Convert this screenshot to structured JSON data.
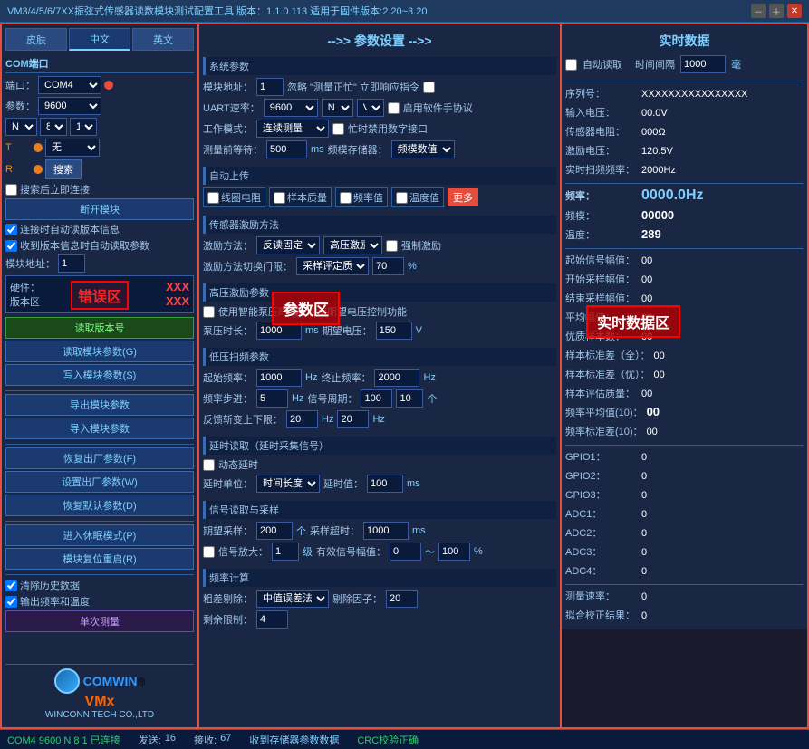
{
  "titlebar": {
    "title": "VM3/4/5/6/7XX振弦式传感器读数模块测试配置工具  版本：1.1.0.113 适用于固件版本:2.20~3.20"
  },
  "tabs": {
    "skin": "皮肤",
    "chinese": "中文",
    "english": "英文"
  },
  "left": {
    "com_section": "COM端口",
    "port_label": "端口：",
    "port_value": "COM4",
    "port_dot": "red",
    "baud_label": "参数：",
    "baud_value": "9600",
    "n_label": "N",
    "b_label": "8",
    "one_label": "1",
    "t_label": "T",
    "r_label": "R",
    "no_label": "无",
    "search_btn": "搜索",
    "auto_connect": "搜索后立即连接",
    "disconnect_btn": "断开模块",
    "auto_version": "连接时自动读版本信息",
    "auto_read": "收到版本信息时自动读取参数",
    "addr_label": "模块地址：",
    "addr_value": "1",
    "hw_label": "硬件：",
    "hw_value": "XXX",
    "sw_label": "版本区",
    "sw_value": "XXX",
    "read_btn": "读取版本号",
    "read_module_btn": "读取模块参数(G)",
    "write_module_btn": "写入模块参数(S)",
    "export_btn": "导出模块参数",
    "import_btn": "导入模块参数",
    "restore_factory_btn": "恢复出厂参数(F)",
    "set_factory_btn": "设置出厂参数(W)",
    "restore_default_btn": "恢复默认参数(D)",
    "sleep_btn": "进入休眠模式(P)",
    "reboot_btn": "模块复位重启(R)",
    "clear_history": "清除历史数据",
    "output_freq_temp": "输出频率和温度",
    "single_measure": "单次测量"
  },
  "middle": {
    "title": "-->>\t参数设置\t -->>",
    "system_params": "系统参数",
    "module_addr_label": "模块地址：",
    "module_addr_value": "1",
    "ignore_label": "忽略 \"测量正忙\" 立即响应指令",
    "uart_label": "UART速率：",
    "uart_value": "9600",
    "n_value": "N",
    "v_value": "V",
    "startup_handshake": "启用软件手协议",
    "work_mode_label": "工作模式：",
    "work_mode_value": "连续测量",
    "busy_disable_digital": "忙时禁用数字接口",
    "wait_ms_label": "测量前等待：",
    "wait_ms_value": "500",
    "wait_ms_unit": "ms",
    "freq_store_label": "频模存储器：",
    "freq_store_value": "频模数值",
    "auto_upload_title": "自动上传",
    "coil_resist": "线圈电阻",
    "sample_quality": "样本质量",
    "freq_value_cb": "频率值",
    "temp_value_cb": "温度值",
    "more_btn": "更多",
    "sensor_excite_title": "传感器激励方法",
    "excite_method_label": "激励方法：",
    "excite_method_value": "反读固定",
    "excite_type_value": "高压激励",
    "force_excite": "强制激励",
    "switch_limit_label": "激励方法切换门限：",
    "switch_limit_value": "采样评定质量值",
    "switch_limit_num": "70",
    "switch_limit_unit": "%",
    "high_voltage_title": "高压激励参数",
    "smart_pump": "使用智能泵压时",
    "param_area": "参数区",
    "enable_period_control": "启用期望电压控制功能",
    "pump_time_label": "泵压时长：",
    "pump_time_value": "1000",
    "pump_time_unit": "ms",
    "expected_voltage_label": "期望电压：",
    "expected_voltage_value": "150",
    "expected_voltage_unit": "V",
    "low_scan_title": "低压扫频参数",
    "start_freq_label": "起始频率：",
    "start_freq_value": "1000",
    "start_freq_unit": "Hz",
    "end_freq_label": "终止频率：",
    "end_freq_value": "2000",
    "end_freq_unit": "Hz",
    "freq_step_label": "频率步进：",
    "freq_step_value": "5",
    "freq_step_unit": "Hz",
    "signal_period_label": "信号周期：",
    "signal_period_value1": "100",
    "signal_period_value2": "10",
    "signal_period_unit": "个",
    "feedback_min_label": "反馈斩变上下限：",
    "feedback_min_value": "20",
    "feedback_min_unit": "Hz",
    "feedback_max_value": "20",
    "feedback_max_unit": "Hz",
    "delay_title": "延时读取（延时采集信号）",
    "dynamic_delay": "动态延时",
    "delay_unit_label": "延时单位：",
    "delay_unit_value": "时间长度",
    "delay_value_label": "延时值：",
    "delay_value": "100",
    "delay_unit": "ms",
    "sample_title": "信号读取与采样",
    "expected_sample_label": "期望采样：",
    "expected_sample_value": "200",
    "expected_sample_unit": "个",
    "sample_timeout_label": "采样超时：",
    "sample_timeout_value": "1000",
    "sample_timeout_unit": "ms",
    "signal_gain_label": "信号放大：",
    "signal_gain_value": "1",
    "signal_gain_unit": "级",
    "valid_amplitude_label": "有效信号幅值：",
    "valid_amplitude_min": "0",
    "valid_amplitude_max": "100",
    "valid_amplitude_unit": "%",
    "freq_calc_title": "频率计算",
    "coarse_remove_label": "粗差剔除：",
    "coarse_remove_value": "中值误差法",
    "remove_factor_label": "剔除因子：",
    "remove_factor_value": "20",
    "remainder_limit_label": "剩余限制：",
    "remainder_limit_value": "4"
  },
  "right": {
    "title": "实时数据",
    "auto_read": "自动读取",
    "time_interval_label": "时间间隔",
    "time_interval_value": "1000",
    "time_interval_unit": "毫",
    "serial_label": "序列号：",
    "serial_value": "XXXXXXXXXXXXXXXX",
    "input_voltage_label": "输入电压：",
    "input_voltage_value": "00.0V",
    "sensor_resist_label": "传感器电阻：",
    "sensor_resist_value": "000Ω",
    "excite_voltage_label": "激励电压：",
    "excite_voltage_value": "120.5V",
    "scan_freq_label": "实时扫频频率：",
    "scan_freq_value": "2000Hz",
    "freq_label": "频率：",
    "freq_value": "0000.0Hz",
    "freq_mod_label": "频模：",
    "freq_mod_value": "00000",
    "temp_label": "温度：",
    "temp_value": "289",
    "start_amplitude_label": "起始信号幅值：",
    "start_amplitude_value": "00",
    "sample_start_label": "开始采样幅值：",
    "sample_start_value": "00",
    "sample_end_label": "结束采样幅值：",
    "sample_end_value": "00",
    "avg_amplitude_label": "平均幅值：",
    "avg_amplitude_value": "00",
    "good_samples_label": "优质样本数：",
    "good_samples_value": "00",
    "sample_std_all_label": "样本标准差（全）：",
    "sample_std_all_value": "00",
    "sample_std_good_label": "样本标准差（优）：",
    "sample_std_good_value": "00",
    "sample_quality_label": "样本评估质量：",
    "sample_quality_value": "00",
    "freq_avg10_label": "频率平均值(10)：",
    "freq_avg10_value": "00",
    "freq_std10_label": "频率标准差(10)：",
    "freq_std10_value": "00",
    "gpio1_label": "GPIO1：",
    "gpio1_value": "0",
    "gpio2_label": "GPIO2：",
    "gpio2_value": "0",
    "gpio3_label": "GPIO3：",
    "gpio3_value": "0",
    "adc1_label": "ADC1：",
    "adc1_value": "0",
    "adc2_label": "ADC2：",
    "adc2_value": "0",
    "adc3_label": "ADC3：",
    "adc3_value": "0",
    "adc4_label": "ADC4：",
    "adc4_value": "0",
    "measure_rate_label": "测量速率：",
    "measure_rate_value": "0",
    "compare_result_label": "拟合校正结果：",
    "compare_result_value": "0"
  },
  "statusbar": {
    "com_status": "COM4 9600 N 8 1 已连接",
    "send_label": "发送:",
    "send_value": "16",
    "recv_label": "接收:",
    "recv_value": "67",
    "store_label": "收到存储器参数数据",
    "crc_label": "CRC校验正确"
  },
  "overlays": {
    "param_area": "参数区",
    "realtime_area": "实时数据区"
  }
}
